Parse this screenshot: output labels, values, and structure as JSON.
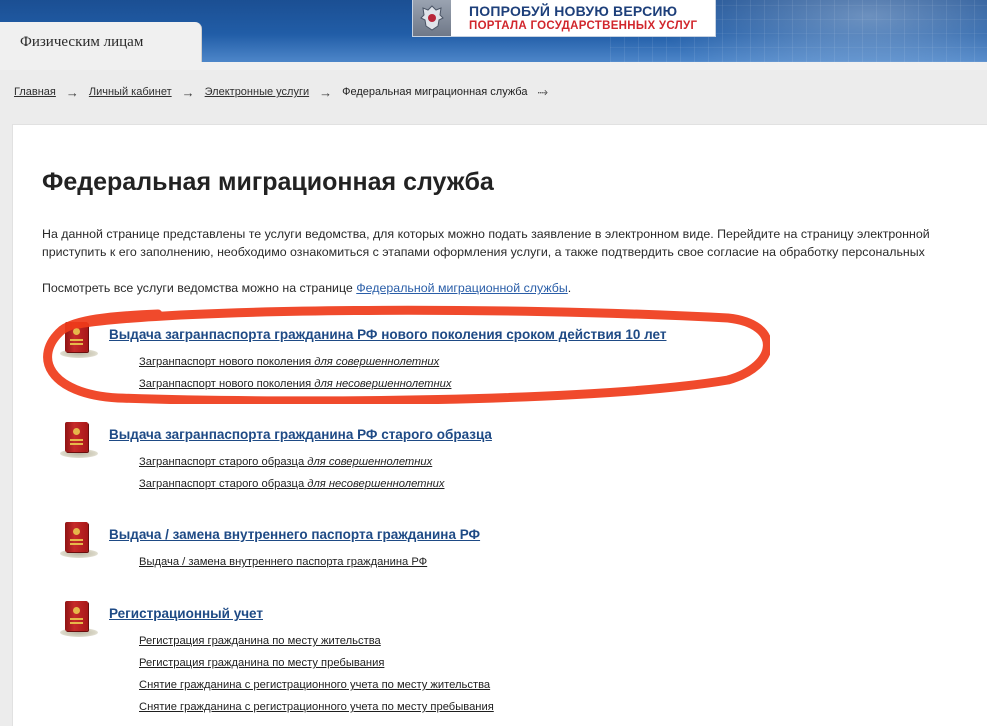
{
  "header": {
    "active_tab": "Физическим лицам",
    "banner_line1": "ПОПРОБУЙ НОВУЮ ВЕРСИЮ",
    "banner_line2": "ПОРТАЛА ГОСУДАРСТВЕННЫХ УСЛУГ"
  },
  "breadcrumb": {
    "items": [
      "Главная",
      "Личный кабинет",
      "Электронные услуги"
    ],
    "current": "Федеральная миграционная служба",
    "separator": "→"
  },
  "page": {
    "title": "Федеральная миграционная служба",
    "intro_line1": "На данной странице представлены те услуги ведомства, для которых можно подать заявление в электронном виде. Перейдите на страницу электронной",
    "intro_line2": "приступить к его заполнению, необходимо ознакомиться с этапами оформления услуги, а также подтвердить свое согласие на обработку персональных",
    "see_all_prefix": "Посмотреть все услуги ведомства можно на странице ",
    "see_all_link": "Федеральной миграционной службы",
    "see_all_suffix": "."
  },
  "services": [
    {
      "title": "Выдача загранпаспорта гражданина РФ нового поколения сроком действия 10 лет",
      "links": [
        {
          "text": "Загранпаспорт нового поколения ",
          "italic": "для совершеннолетних"
        },
        {
          "text": "Загранпаспорт нового поколения ",
          "italic": "для несовершеннолетних"
        }
      ]
    },
    {
      "title": "Выдача загранпаспорта гражданина РФ старого образца",
      "links": [
        {
          "text": "Загранпаспорт старого образца ",
          "italic": "для совершеннолетних"
        },
        {
          "text": "Загранпаспорт старого образца ",
          "italic": "для несовершеннолетних"
        }
      ]
    },
    {
      "title": "Выдача / замена внутреннего паспорта гражданина РФ",
      "links": [
        {
          "text": "Выдача / замена внутреннего паспорта гражданина РФ",
          "italic": ""
        }
      ]
    },
    {
      "title": "Регистрационный учет",
      "links": [
        {
          "text": "Регистрация гражданина по месту жительства",
          "italic": ""
        },
        {
          "text": "Регистрация гражданина по месту пребывания",
          "italic": ""
        },
        {
          "text": "Снятие гражданина с регистрационного учета по месту жительства",
          "italic": ""
        },
        {
          "text": "Снятие гражданина с регистрационного учета по месту пребывания",
          "italic": ""
        }
      ]
    }
  ],
  "colors": {
    "header_blue": "#215da7",
    "title_blue": "#1e4a85",
    "banner_red": "#d1262c",
    "highlight_stroke": "#ef3b1a"
  }
}
